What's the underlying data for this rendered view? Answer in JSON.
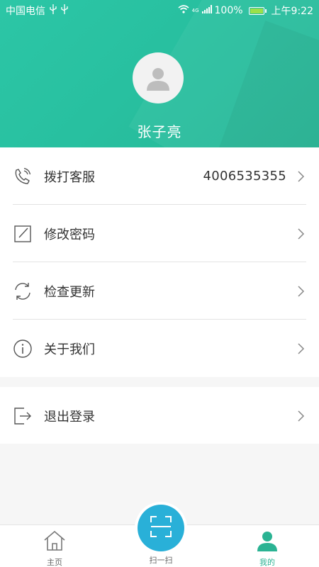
{
  "status_bar": {
    "carrier": "中国电信",
    "network": "4G",
    "battery": "100%",
    "battery_level": 1.0,
    "time": "上午9:22"
  },
  "profile": {
    "name": "张子亮",
    "avatar_icon": "user-avatar-icon"
  },
  "menu": {
    "call_service": {
      "label": "拨打客服",
      "value": "4006535355",
      "icon": "phone-icon"
    },
    "change_password": {
      "label": "修改密码",
      "icon": "edit-icon"
    },
    "check_update": {
      "label": "检查更新",
      "icon": "refresh-icon"
    },
    "about_us": {
      "label": "关于我们",
      "icon": "info-icon"
    },
    "logout": {
      "label": "退出登录",
      "icon": "logout-icon"
    }
  },
  "bottom_nav": {
    "home": "主页",
    "scan": "扫一扫",
    "mine": "我的"
  },
  "colors": {
    "header": "#2cc6a6",
    "scan_button": "#29b0d8",
    "active_tab": "#2ab393"
  }
}
